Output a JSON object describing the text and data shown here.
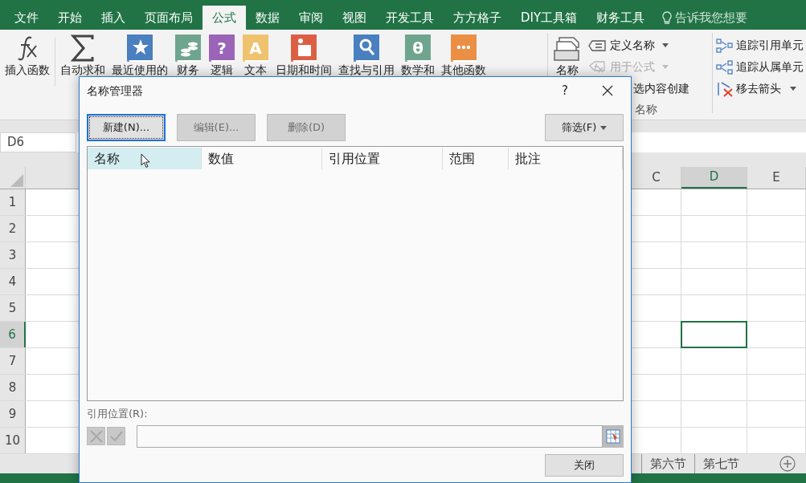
{
  "ribbon_tabs": [
    {
      "label": "文件",
      "selected": false
    },
    {
      "label": "开始",
      "selected": false
    },
    {
      "label": "插入",
      "selected": false
    },
    {
      "label": "页面布局",
      "selected": false
    },
    {
      "label": "公式",
      "selected": true
    },
    {
      "label": "数据",
      "selected": false
    },
    {
      "label": "审阅",
      "selected": false
    },
    {
      "label": "视图",
      "selected": false
    },
    {
      "label": "开发工具",
      "selected": false
    },
    {
      "label": "方方格子",
      "selected": false
    },
    {
      "label": "DIY工具箱",
      "selected": false
    },
    {
      "label": "财务工具",
      "selected": false
    }
  ],
  "tell_me": {
    "placeholder": "告诉我您想要"
  },
  "ribbon_buttons": [
    {
      "label": "插入函数",
      "kind": "fx"
    },
    {
      "label": "自动求和",
      "kind": "sigma"
    },
    {
      "label": "最近使用的",
      "kind": "star",
      "color": "#4a7fc0"
    },
    {
      "label": "财务",
      "kind": "coins",
      "color": "#6fa58e"
    },
    {
      "label": "逻辑",
      "kind": "glyph",
      "color": "#9b64b8",
      "glyph": "?"
    },
    {
      "label": "文本",
      "kind": "glyph",
      "color": "#efc36d",
      "glyph": "A"
    },
    {
      "label": "日期和时间",
      "kind": "calendar",
      "color": "#dc5f45"
    },
    {
      "label": "查找与引用",
      "kind": "search",
      "color": "#4a7fc0"
    },
    {
      "label": "数学和",
      "kind": "glyph",
      "color": "#6fa58e",
      "glyph": "θ"
    },
    {
      "label": "其他函数",
      "kind": "dots",
      "color": "#eb8f45"
    },
    {
      "label": "名称",
      "kind": "names"
    }
  ],
  "defined_names": {
    "items": [
      {
        "label": "定义名称",
        "kind": "tag",
        "disabled": false,
        "dropdown": true
      },
      {
        "label": "用于公式",
        "kind": "fx",
        "disabled": true,
        "dropdown": true
      },
      {
        "label": "选内容创建",
        "kind": "plain",
        "disabled": false,
        "dropdown": false
      }
    ],
    "group_label": "名称"
  },
  "audit": [
    {
      "label": "追踪引用单元",
      "kind": "precedents",
      "dropdown": false
    },
    {
      "label": "追踪从属单元",
      "kind": "dependents",
      "dropdown": false
    },
    {
      "label": "移去箭头",
      "kind": "remove",
      "dropdown": true
    }
  ],
  "name_box": "D6",
  "columns": [
    {
      "label": "C",
      "selected": false
    },
    {
      "label": "D",
      "selected": true
    },
    {
      "label": "E",
      "selected": false
    }
  ],
  "rows": [
    {
      "label": "1",
      "selected": false
    },
    {
      "label": "2",
      "selected": false
    },
    {
      "label": "3",
      "selected": false
    },
    {
      "label": "4",
      "selected": false
    },
    {
      "label": "5",
      "selected": false
    },
    {
      "label": "6",
      "selected": true
    },
    {
      "label": "7",
      "selected": false
    },
    {
      "label": "8",
      "selected": false
    },
    {
      "label": "9",
      "selected": false
    },
    {
      "label": "10",
      "selected": false
    }
  ],
  "sheet_tabs": [
    {
      "label": "第六节",
      "selected": false
    },
    {
      "label": "第七节",
      "selected": false
    }
  ],
  "dialog": {
    "title": "名称管理器",
    "help": "?",
    "buttons": [
      {
        "label": "新建(N)...",
        "disabled": false,
        "focused": true
      },
      {
        "label": "编辑(E)...",
        "disabled": true,
        "focused": false
      },
      {
        "label": "删除(D)",
        "disabled": true,
        "focused": false
      }
    ],
    "filter": "筛选(F)",
    "list_columns": [
      {
        "label": "名称",
        "selected": true
      },
      {
        "label": "数值",
        "selected": false
      },
      {
        "label": "引用位置",
        "selected": false
      },
      {
        "label": "范围",
        "selected": false
      },
      {
        "label": "批注",
        "selected": false
      }
    ],
    "reference_label": "引用位置(R):",
    "edit_buttons_disabled": true,
    "close_button": "关闭"
  }
}
